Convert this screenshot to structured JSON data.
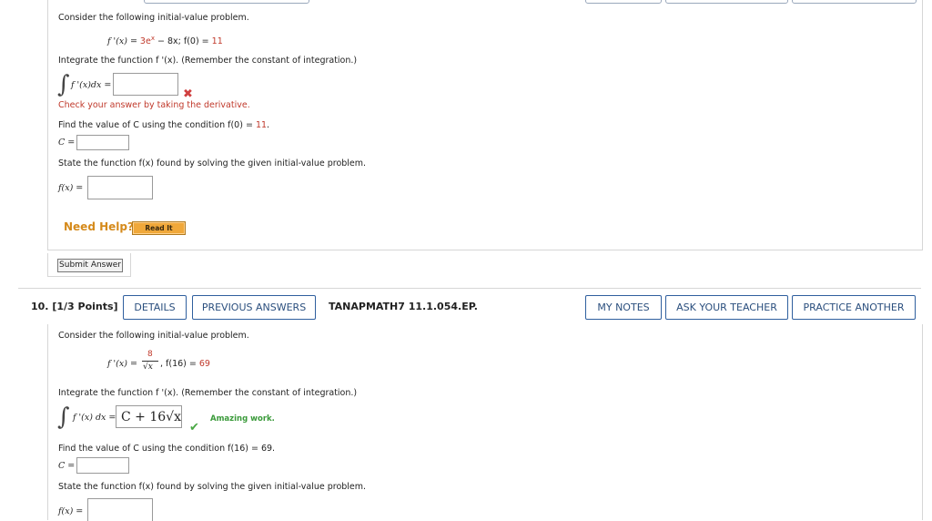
{
  "question9": {
    "intro": "Consider the following initial-value problem.",
    "equation_lhs": "f '(x) = ",
    "equation_rhs": "3e",
    "equation_exp": "x",
    "equation_rest": " − 8x;  f(0) = ",
    "equation_init": "11",
    "integrate_prompt": "Integrate the function f '(x). (Remember the constant of integration.)",
    "integral_label": "f '(x)dx = ",
    "integral_value": "",
    "hint": "Check your answer by taking the derivative.",
    "find_c_prompt": "Find the value of C using the condition f(0) = ",
    "find_c_value": "11",
    "find_c_period": ".",
    "c_label": "C = ",
    "c_value": "",
    "state_prompt": "State the function f(x) found by solving the given initial-value problem.",
    "fx_label": "f(x) = ",
    "fx_value": "",
    "need_help": "Need Help?",
    "read_it": "Read It",
    "submit": "Submit Answer"
  },
  "question10": {
    "number": "10.",
    "points": "[1/3 Points]",
    "details_btn": "DETAILS",
    "previous_btn": "PREVIOUS ANSWERS",
    "code": "TANAPMATH7 11.1.054.EP.",
    "my_notes_btn": "MY NOTES",
    "ask_teacher_btn": "ASK YOUR TEACHER",
    "practice_btn": "PRACTICE ANOTHER",
    "intro": "Consider the following initial-value problem.",
    "equation_lhs": "f '(x) = ",
    "numerator": "8",
    "denominator": "√x",
    "equation_rest": ",  f(16) = ",
    "equation_init": "69",
    "integrate_prompt": "Integrate the function f '(x). (Remember the constant of integration.)",
    "integral_label": "f '(x) dx = ",
    "integral_value": "C + 16√x",
    "feedback": "Amazing work.",
    "find_c_prompt": "Find the value of C using the condition f(16) = 69.",
    "c_label": "C = ",
    "c_value": "",
    "state_prompt": "State the function f(x) found by solving the given initial-value problem.",
    "fx_label": "f(x) = ",
    "fx_value": ""
  }
}
